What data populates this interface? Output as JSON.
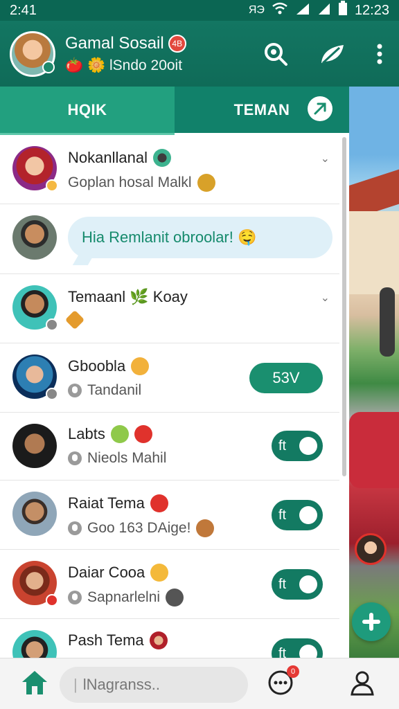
{
  "status_bar": {
    "time_left": "2:41",
    "signal_text": "ЯЭ",
    "time_right": "12:23"
  },
  "header": {
    "name": "Gamal Sosail",
    "badge": "4B",
    "status": "🍅 🌼 lSndo 20oit"
  },
  "tabs": [
    {
      "label": "HQIK",
      "active": true
    },
    {
      "label": "TEMAN",
      "active": false
    }
  ],
  "chats": [
    {
      "name": "Nokanllanal",
      "sub": "Goplan hosal Malkl",
      "type": "text"
    },
    {
      "bubble": "Hia Remlanit obroolar! 🤤",
      "type": "bubble"
    },
    {
      "name": "Temaanl 🌿 Koay",
      "sub": "",
      "type": "text"
    },
    {
      "name": "Gboobla",
      "sub": "Tandanil",
      "pill": "53V",
      "type": "count"
    },
    {
      "name": "Labts",
      "sub": "Nieols Mahil",
      "pill": "ft",
      "type": "toggle"
    },
    {
      "name": "Raiat Tema",
      "sub": "Goo 163 DAige!",
      "pill": "ft",
      "type": "toggle"
    },
    {
      "name": "Daiar Cooa",
      "sub": "Sapnarlelni",
      "pill": "ft",
      "type": "toggle"
    },
    {
      "name": "Pash Tema",
      "sub": "",
      "pill": "ft",
      "type": "toggle"
    }
  ],
  "bottom": {
    "search_placeholder": "lNagranss..",
    "chat_notif": "0"
  },
  "colors": {
    "primary": "#137662",
    "accent": "#22a07f",
    "pill": "#1a8f6f"
  }
}
